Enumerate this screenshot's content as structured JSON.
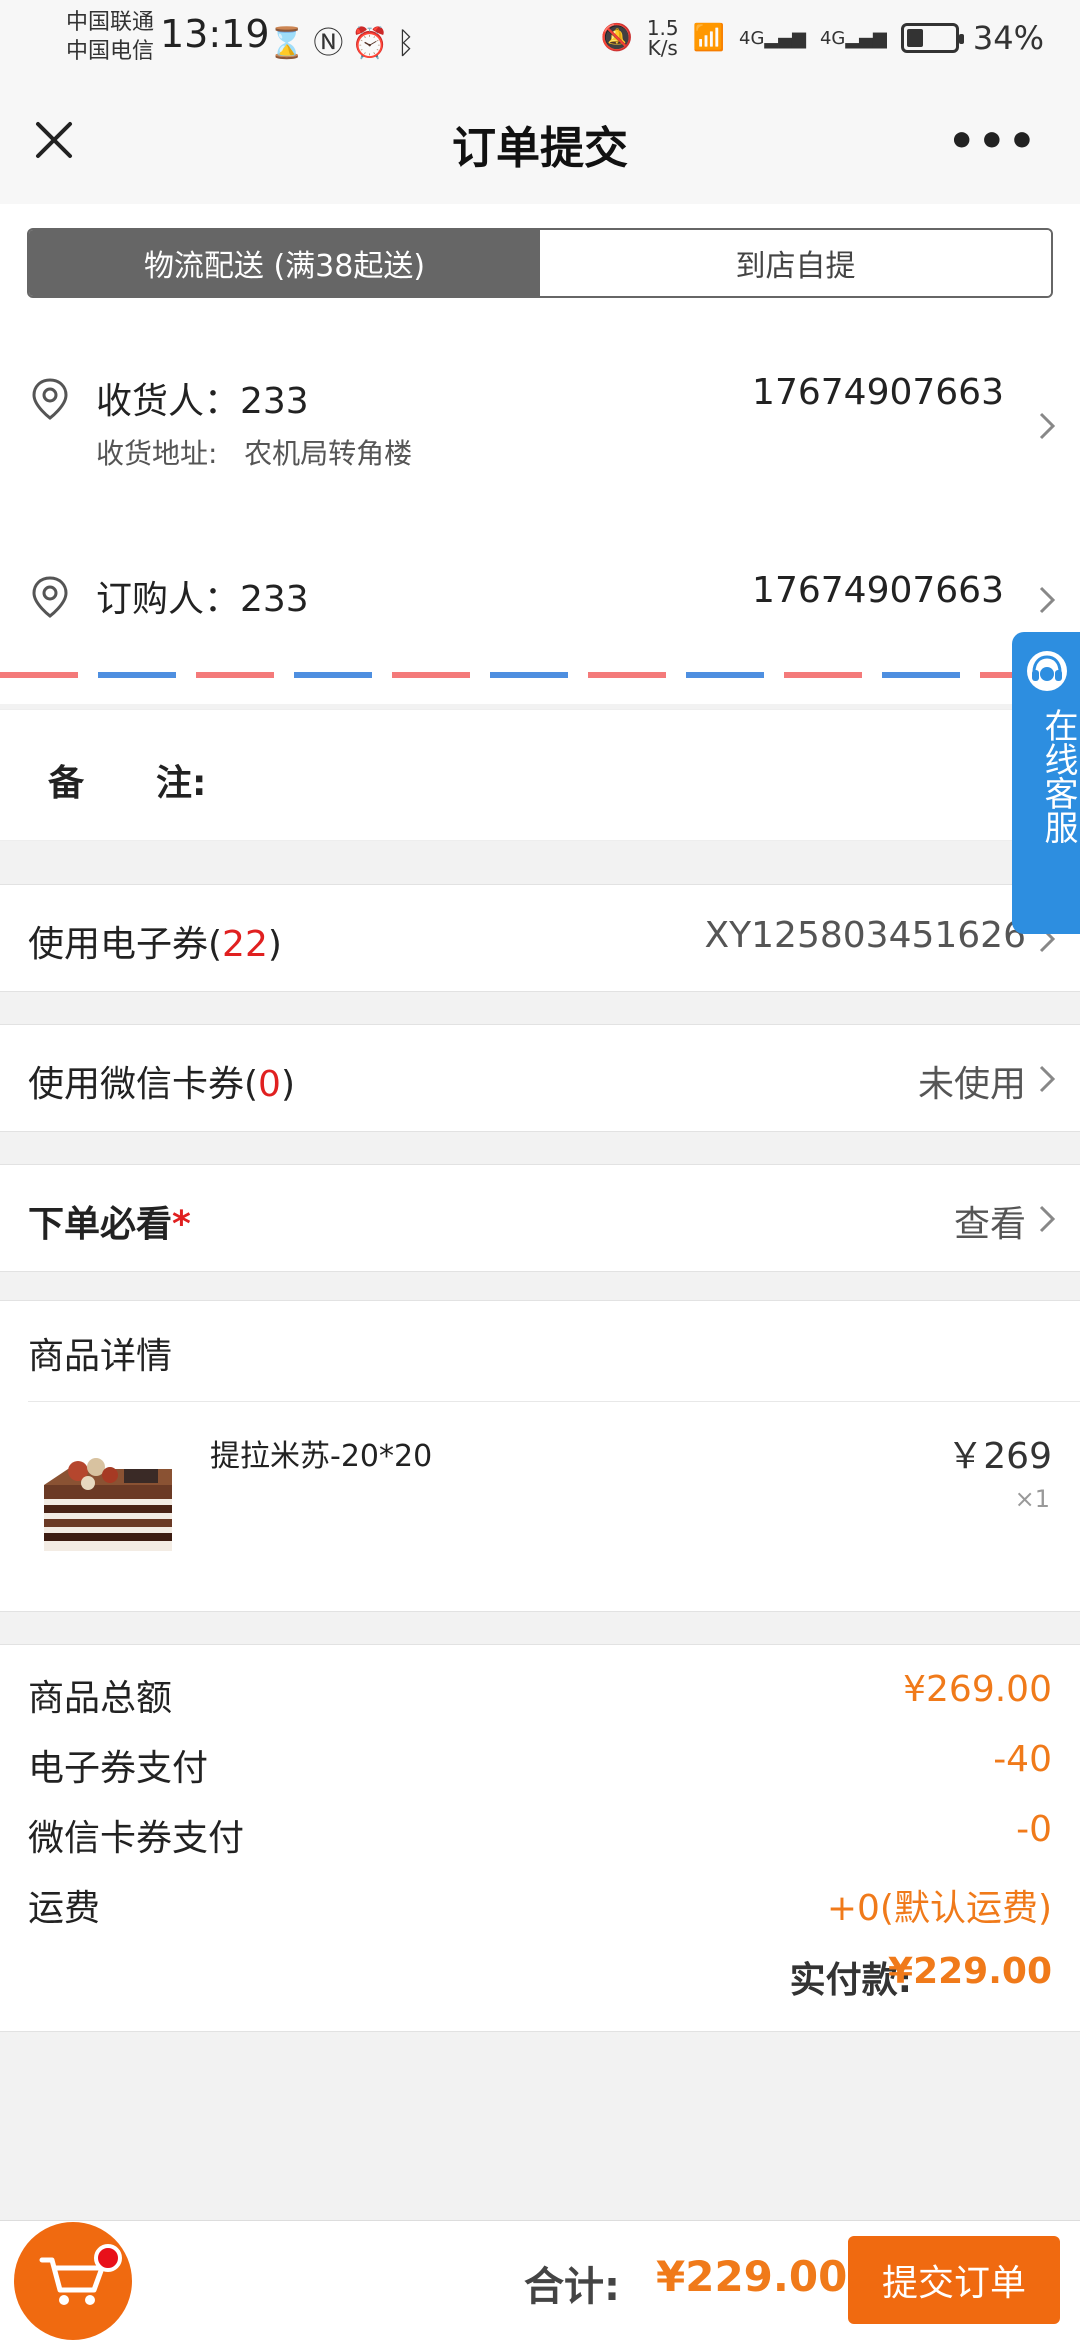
{
  "status_bar": {
    "carrier1": "中国联通",
    "carrier2": "中国电信",
    "time": "13:19",
    "speed_value": "1.5",
    "speed_unit": "K/s",
    "network1": "4G",
    "network2": "4G",
    "battery": "34%",
    "battery_level": 0.34
  },
  "nav": {
    "title": "订单提交"
  },
  "delivery_tabs": {
    "active": "物流配送 (满38起送)",
    "inactive": "到店自提"
  },
  "receiver": {
    "label": "收货人：233",
    "phone": "17674907663",
    "address_label": "收货地址:",
    "address": "农机局转角楼"
  },
  "buyer": {
    "label": "订购人：233",
    "phone": "17674907663"
  },
  "remark": {
    "label": "备　　注:"
  },
  "e_coupon": {
    "label_prefix": "使用电子券(",
    "count": "22",
    "label_suffix": ")",
    "value": "XY125803451626"
  },
  "wechat_coupon": {
    "label_prefix": "使用微信卡券(",
    "count": "0",
    "label_suffix": ")",
    "value": "未使用"
  },
  "must_read": {
    "label": "下单必看",
    "asterisk": "*",
    "value": "查看"
  },
  "goods": {
    "title": "商品详情",
    "items": [
      {
        "name": "提拉米苏-20*20",
        "price": "￥269",
        "qty": "×1"
      }
    ]
  },
  "totals": {
    "goods_total_label": "商品总额",
    "goods_total": "¥269.00",
    "e_coupon_label": "电子券支付",
    "e_coupon_amount": "-40",
    "wechat_label": "微信卡券支付",
    "wechat_amount": "-0",
    "shipping_label": "运费",
    "shipping_amount": "+0(默认运费)",
    "paid_label": "实付款:",
    "paid_amount": "¥229.00"
  },
  "customer_service": {
    "label": "在线客服"
  },
  "bottom_bar": {
    "total_label": "合计:",
    "total": "¥229.00",
    "submit": "提交订单"
  },
  "colors": {
    "accent": "#f07a1a",
    "button": "#f06a10",
    "tab_active": "#666666",
    "cs_blue": "#2d8ee0",
    "red": "#e02020"
  }
}
